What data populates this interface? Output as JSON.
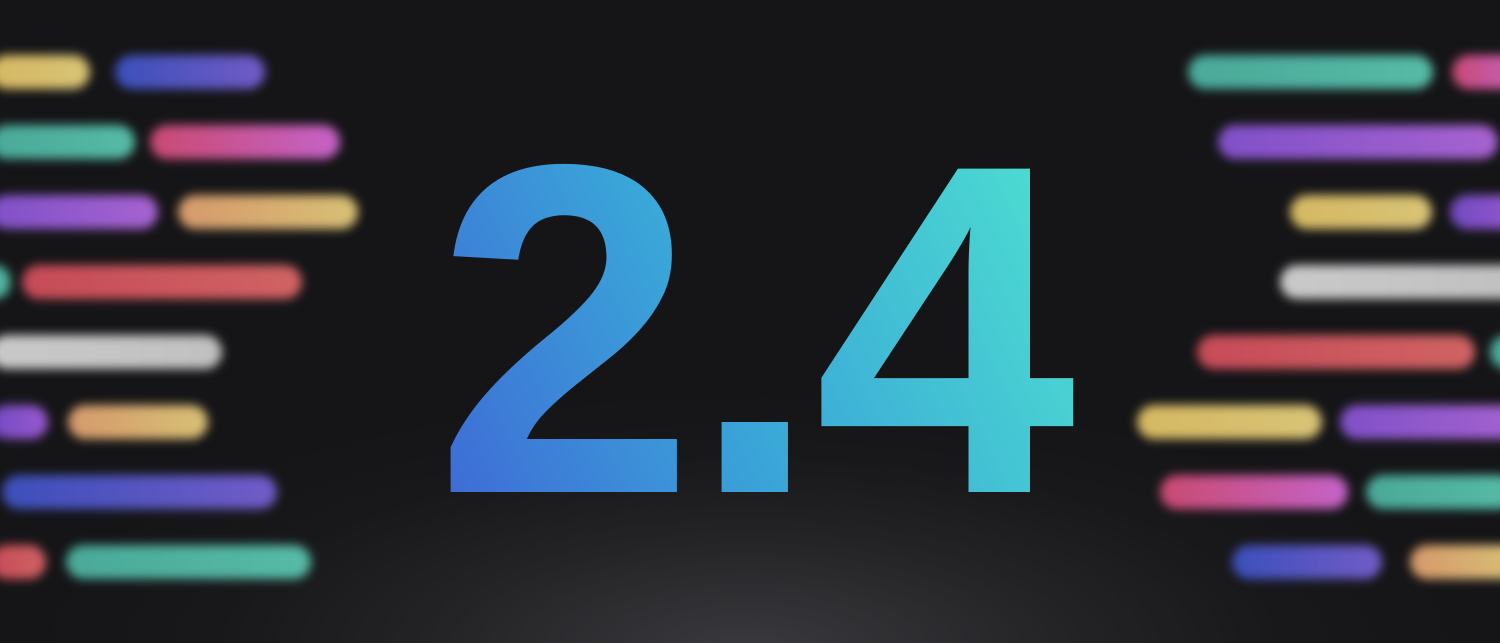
{
  "version": {
    "label": "2.4"
  },
  "colors": {
    "background": "#161618",
    "gradient_start": "#3f5fd6",
    "gradient_mid": "#3aa6d8",
    "gradient_end": "#4fe6cf"
  },
  "decoration": {
    "bar_colors": [
      "yellow",
      "blue",
      "teal",
      "pink",
      "purple",
      "peach",
      "red",
      "gray",
      "violet"
    ]
  }
}
